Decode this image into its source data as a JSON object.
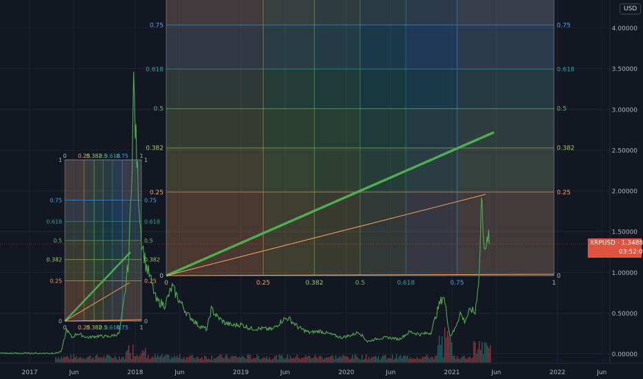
{
  "currency_label": "USD",
  "symbol_tag": {
    "symbol": "XRPUSD",
    "price": "1.34888",
    "countdown": "03:52:06"
  },
  "chart_data": {
    "type": "line",
    "xlabel": "",
    "ylabel": "",
    "ylim": [
      0,
      4.3
    ],
    "y_ticks": [
      "4.00000",
      "3.50000",
      "3.00000",
      "2.50000",
      "2.00000",
      "1.50000",
      "1.00000",
      "0.50000",
      "0.00000"
    ],
    "y_tick_values": [
      4.0,
      3.5,
      3.0,
      2.5,
      2.0,
      1.5,
      1.0,
      0.5,
      0.0
    ],
    "x_ticks": [
      {
        "label": "2017",
        "t": 2017.0
      },
      {
        "label": "Jun",
        "t": 2017.42
      },
      {
        "label": "2018",
        "t": 2018.0
      },
      {
        "label": "Jun",
        "t": 2018.42
      },
      {
        "label": "2019",
        "t": 2019.0
      },
      {
        "label": "Jun",
        "t": 2019.42
      },
      {
        "label": "2020",
        "t": 2020.0
      },
      {
        "label": "Jun",
        "t": 2020.42
      },
      {
        "label": "2021",
        "t": 2021.0
      },
      {
        "label": "Jun",
        "t": 2021.42
      },
      {
        "label": "2022",
        "t": 2022.0
      },
      {
        "label": "Jun",
        "t": 2022.42
      }
    ],
    "series": [
      {
        "color": "#4caf50",
        "points": [
          [
            2016.7,
            0.006
          ],
          [
            2017.1,
            0.007
          ],
          [
            2017.25,
            0.01
          ],
          [
            2017.3,
            0.03
          ],
          [
            2017.35,
            0.3
          ],
          [
            2017.4,
            0.2
          ],
          [
            2017.45,
            0.25
          ],
          [
            2017.55,
            0.2
          ],
          [
            2017.65,
            0.22
          ],
          [
            2017.75,
            0.21
          ],
          [
            2017.85,
            0.25
          ],
          [
            2017.9,
            0.7
          ],
          [
            2017.94,
            1.2
          ],
          [
            2017.97,
            2.4
          ],
          [
            2017.985,
            3.3
          ],
          [
            2018.0,
            2.8
          ],
          [
            2018.03,
            2.0
          ],
          [
            2018.06,
            1.4
          ],
          [
            2018.1,
            1.1
          ],
          [
            2018.15,
            0.9
          ],
          [
            2018.2,
            0.65
          ],
          [
            2018.28,
            0.6
          ],
          [
            2018.35,
            0.82
          ],
          [
            2018.42,
            0.65
          ],
          [
            2018.5,
            0.48
          ],
          [
            2018.6,
            0.35
          ],
          [
            2018.68,
            0.3
          ],
          [
            2018.72,
            0.55
          ],
          [
            2018.78,
            0.45
          ],
          [
            2018.85,
            0.38
          ],
          [
            2018.92,
            0.35
          ],
          [
            2019.0,
            0.36
          ],
          [
            2019.1,
            0.31
          ],
          [
            2019.2,
            0.31
          ],
          [
            2019.3,
            0.3
          ],
          [
            2019.4,
            0.42
          ],
          [
            2019.45,
            0.44
          ],
          [
            2019.55,
            0.32
          ],
          [
            2019.65,
            0.26
          ],
          [
            2019.75,
            0.28
          ],
          [
            2019.85,
            0.24
          ],
          [
            2019.95,
            0.2
          ],
          [
            2020.05,
            0.23
          ],
          [
            2020.12,
            0.27
          ],
          [
            2020.2,
            0.15
          ],
          [
            2020.3,
            0.19
          ],
          [
            2020.4,
            0.2
          ],
          [
            2020.5,
            0.18
          ],
          [
            2020.6,
            0.27
          ],
          [
            2020.7,
            0.24
          ],
          [
            2020.8,
            0.26
          ],
          [
            2020.88,
            0.6
          ],
          [
            2020.92,
            0.72
          ],
          [
            2020.95,
            0.5
          ],
          [
            2020.98,
            0.22
          ],
          [
            2021.02,
            0.28
          ],
          [
            2021.08,
            0.5
          ],
          [
            2021.12,
            0.4
          ],
          [
            2021.18,
            0.55
          ],
          [
            2021.22,
            0.5
          ],
          [
            2021.26,
            1.0
          ],
          [
            2021.28,
            1.9
          ],
          [
            2021.3,
            1.5
          ],
          [
            2021.32,
            1.2
          ],
          [
            2021.34,
            1.45
          ],
          [
            2021.355,
            1.35
          ]
        ]
      }
    ],
    "fib_levels": [
      {
        "label": "0",
        "color": "#b2b5be"
      },
      {
        "label": "0.25",
        "color": "#f7a35c"
      },
      {
        "label": "0.382",
        "color": "#9ccc65"
      },
      {
        "label": "0.5",
        "color": "#66bb6a"
      },
      {
        "label": "0.618",
        "color": "#26a69a"
      },
      {
        "label": "0.75",
        "color": "#42a5f5"
      },
      {
        "label": "1",
        "color": "#b2b5be"
      }
    ]
  }
}
